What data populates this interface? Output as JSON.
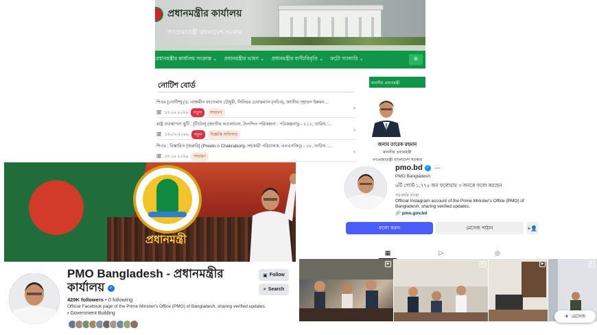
{
  "website": {
    "site_title": "প্রধানমন্ত্রীর কার্যালয়",
    "site_subtitle": "গণপ্রজাতন্ত্রী বাংলাদেশ সরকার",
    "nav": [
      {
        "label": "প্রধানমন্ত্রীর কার্যালয় সংক্রান্ত ⌄"
      },
      {
        "label": "প্রধানমন্ত্রীর ভাষণ ⌄"
      },
      {
        "label": "প্রধানমন্ত্রীর বাণী/বিবৃতি ⌄"
      },
      {
        "label": "ফটো গ্যালারি ⌄"
      }
    ],
    "menu_icon": "≡",
    "notice_board_title": "নোটিশ বোর্ড",
    "notices": [
      {
        "text": "শিওঃ [নোটিশ] (ড. নাজমীন ফাতেমান চৌধুরী, সিনিয়র চেয়ারম্যান (সচিব), জাতীয় গৃহায়ন উন্নয়ন...",
        "date": "১৭ ০২ ২০২৬",
        "badge": "নতুন",
        "category": "সাধারণ"
      },
      {
        "text": "রাষ্ট্র ব্যবস্থাপনা ছুটি : [টিটেন] (জাতীয় আলোচনা, দৈনন্দিন পরিকল্পনা : পরিকল্পনা)) - ১১১, তারিখ :...",
        "date": "১৩-০২-২০২৬",
        "badge": "নতুন",
        "category": "বিজ্ঞপ্তি অফিসার"
      },
      {
        "text": "শিওঃ : বিস্তারিত [জরুরি] (Preeto n Chakraborty, সহকারী পরিচালক, এনএসজি)) - ১৮, তারিখ :...",
        "date": "১৩ ০২ ২০২৬",
        "badge": "",
        "category": "সাধারণ"
      }
    ],
    "chevron": "›",
    "sidebar_header": "মাননীয় প্রধানমন্ত্রী",
    "pm_name": "জনাব তারেক রহমান",
    "pm_role": "মাননীয় প্রধানমন্ত্রী",
    "pm_govt": "গণপ্রজাতন্ত্রী বাংলাদেশ সরকার"
  },
  "facebook": {
    "cover_word": "প্রধানমন্ত্রী",
    "page_name": "PMO Bangladesh - প্রধানমন্ত্রীর কার্যালয়",
    "verified_glyph": "✓",
    "followers": "429K followers",
    "following": " • 0 following",
    "description": "Official Facebook page of the Prime Minister's Office (PMO) of Bangladesh, sharing verified updates.",
    "category": "Government Building",
    "follow_label": "Follow",
    "search_label": "Search",
    "colors": {
      "brand_blue": "#1877f2"
    }
  },
  "instagram": {
    "username": "pmo.bd",
    "verified_glyph": "✓",
    "more": "···",
    "full_name": "PMO Bangladesh",
    "stats": "৬টি পোস্ট   ১,৭৭৫ জন ফলোয়ার   ৩ জনকে ফলো করছেন",
    "org_category": "সরকারি সংস্থা",
    "bio": "Official Instagram account of the Prime Minister's Office (PMO) of Bangladesh, sharing verified updates.",
    "link": "pmo.gov.bd",
    "follow_label": "ফলো করুন",
    "message_label": "মেসেজ পাঠান",
    "add_icon": "+👤",
    "tabs": [
      {
        "name": "posts-grid",
        "glyph": "▦"
      },
      {
        "name": "reels",
        "glyph": "▷"
      },
      {
        "name": "tagged",
        "glyph": "◎"
      }
    ],
    "messages_bar_label": "মেসেজ",
    "colors": {
      "follow_button": "#4a5df9"
    }
  }
}
